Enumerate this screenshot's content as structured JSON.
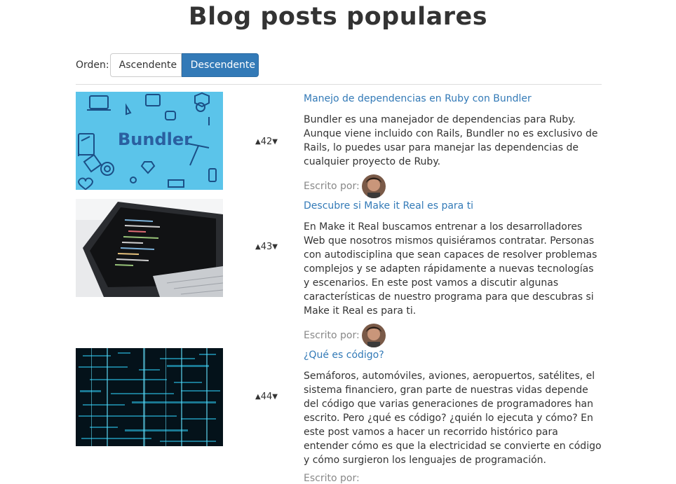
{
  "page": {
    "title": "Blog posts populares"
  },
  "order": {
    "label": "Orden:",
    "asc_label": "Ascendente",
    "desc_label": "Descendente",
    "selected": "Descendente"
  },
  "posts": [
    {
      "title": "Manejo de dependencias en Ruby con Bundler",
      "votes": "42",
      "excerpt": "Bundler es una manejador de dependencias para Ruby. Aunque viene incluido con Rails, Bundler no es exclusivo de Rails, lo puedes usar para manejar las dependencias de cualquier proyecto de Ruby.",
      "author_label": "Escrito por:",
      "image_text": "Bundler"
    },
    {
      "title": "Descubre si Make it Real es para ti",
      "votes": "43",
      "excerpt": "En Make it Real buscamos entrenar a los desarrolladores Web que nosotros mismos quisiéramos contratar. Personas con autodisciplina que sean capaces de resolver problemas complejos y se adapten rápidamente a nuevas tecnologías y escenarios. En este post vamos a discutir algunas características de nuestro programa para que descubras si Make it Real es para ti.",
      "author_label": "Escrito por:"
    },
    {
      "title": "¿Qué es código?",
      "votes": "44",
      "excerpt": "Semáforos, automóviles, aviones, aeropuertos, satélites, el sistema financiero, gran parte de nuestras vidas depende del código que varias generaciones de programadores han escrito. Pero ¿qué es código? ¿quién lo ejecuta y cómo? En este post vamos a hacer un recorrido histórico para entender cómo es que la electricidad se convierte en código y cómo surgieron los lenguajes de programación.",
      "author_label": "Escrito por:"
    }
  ],
  "colors": {
    "link": "#337ab7",
    "button_active": "#337ab7",
    "bundler_bg": "#5bc4ea",
    "code_bg": "#04121a"
  }
}
